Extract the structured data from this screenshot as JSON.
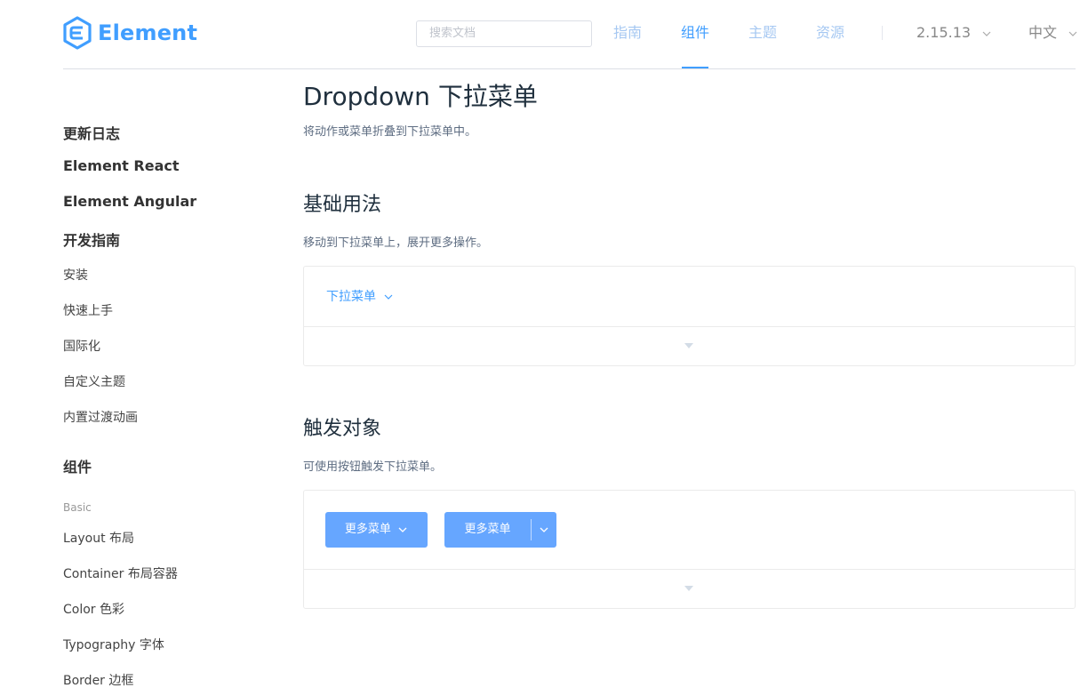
{
  "header": {
    "logo_text": "Element",
    "search_placeholder": "搜索文档",
    "nav": [
      {
        "label": "指南",
        "active": false
      },
      {
        "label": "组件",
        "active": true
      },
      {
        "label": "主题",
        "active": false
      },
      {
        "label": "资源",
        "active": false
      }
    ],
    "version": "2.15.13",
    "language": "中文"
  },
  "sidebar": {
    "groups": [
      {
        "label": "更新日志"
      },
      {
        "label": "Element React"
      },
      {
        "label": "Element Angular"
      },
      {
        "label": "开发指南"
      }
    ],
    "guide_items": [
      "安装",
      "快速上手",
      "国际化",
      "自定义主题",
      "内置过渡动画"
    ],
    "components_label": "组件",
    "basic_label": "Basic",
    "basic_items": [
      "Layout 布局",
      "Container 布局容器",
      "Color 色彩",
      "Typography 字体",
      "Border 边框"
    ]
  },
  "main": {
    "title": "Dropdown 下拉菜单",
    "description": "将动作或菜单折叠到下拉菜单中。",
    "sections": [
      {
        "title": "基础用法",
        "description": "移动到下拉菜单上，展开更多操作。",
        "demo_link": "下拉菜单"
      },
      {
        "title": "触发对象",
        "description": "可使用按钮触发下拉菜单。",
        "button1": "更多菜单",
        "button2": "更多菜单"
      }
    ]
  },
  "colors": {
    "primary": "#409eff",
    "button": "#66a6ff",
    "border": "#ebebeb"
  }
}
